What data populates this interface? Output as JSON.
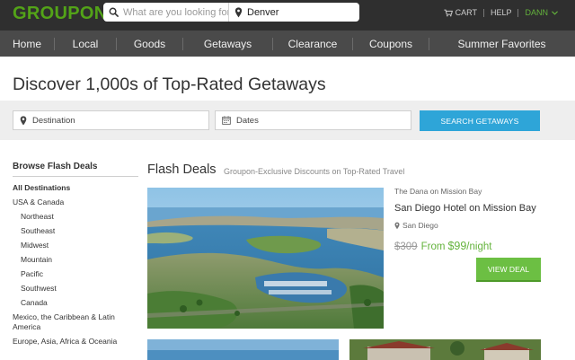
{
  "header": {
    "logo": "GROUPON",
    "search_placeholder": "What are you looking for?",
    "location_value": "Denver",
    "cart_label": "CART",
    "help_label": "HELP",
    "user_label": "DANN"
  },
  "nav": {
    "items": [
      "Home",
      "Local",
      "Goods",
      "Getaways",
      "Clearance",
      "Coupons",
      "Summer Favorites"
    ]
  },
  "hero": {
    "title": "Discover 1,000s of Top-Rated Getaways"
  },
  "getaway_search": {
    "destination_placeholder": "Destination",
    "dates_placeholder": "Dates",
    "button_label": "SEARCH GETAWAYS"
  },
  "sidebar": {
    "title": "Browse Flash Deals",
    "items": [
      "All Destinations",
      "USA & Canada",
      "Northeast",
      "Southeast",
      "Midwest",
      "Mountain",
      "Pacific",
      "Southwest",
      "Canada",
      "Mexico, the Caribbean & Latin America",
      "Europe, Asia, Africa & Oceania"
    ]
  },
  "flash_deals": {
    "title": "Flash Deals",
    "subtitle": "Groupon-Exclusive Discounts on Top-Rated Travel",
    "deal": {
      "merchant": "The Dana on Mission Bay",
      "title": "San Diego Hotel on Mission Bay",
      "location": "San Diego",
      "old_price": "$309",
      "from_label": "From",
      "new_price": "$99",
      "per_label": "/night",
      "button_label": "VIEW DEAL"
    }
  },
  "colors": {
    "brand_green": "#53a318",
    "header_bg": "#2f2f2f",
    "nav_bg": "#4a4a4a",
    "search_button": "#2ea5d8",
    "view_button": "#6cbf43"
  }
}
